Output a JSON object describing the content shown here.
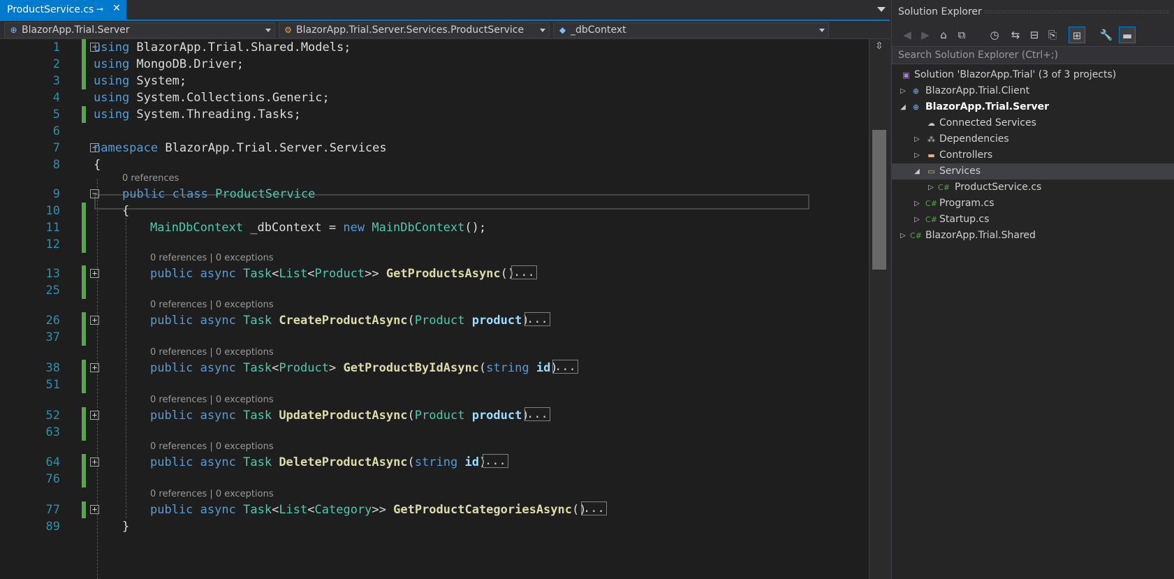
{
  "editor": {
    "tab": {
      "title": "ProductService.cs",
      "pin_glyph": "⊸",
      "close_glyph": "✕"
    },
    "nav": {
      "project": "BlazorApp.Trial.Server",
      "type": "BlazorApp.Trial.Server.Services.ProductService",
      "member": "_dbContext"
    },
    "lines": [
      {
        "n": "1",
        "text": "using BlazorApp.Trial.Shared.Models;"
      },
      {
        "n": "2",
        "text": "using MongoDB.Driver;"
      },
      {
        "n": "3",
        "text": "using System;"
      },
      {
        "n": "4",
        "text": "using System.Collections.Generic;"
      },
      {
        "n": "5",
        "text": "using System.Threading.Tasks;"
      },
      {
        "n": "6",
        "text": ""
      },
      {
        "n": "7",
        "text": "namespace BlazorApp.Trial.Server.Services"
      },
      {
        "n": "8",
        "text": "{"
      },
      {
        "n": "9",
        "text": "public class ProductService"
      },
      {
        "n": "10",
        "text": "{"
      },
      {
        "n": "11",
        "text": "MainDbContext _dbContext = new MainDbContext();"
      },
      {
        "n": "12",
        "text": ""
      },
      {
        "n": "13",
        "text": "public async Task<List<Product>> GetProductsAsync()"
      },
      {
        "n": "25",
        "text": ""
      },
      {
        "n": "26",
        "text": "public async Task CreateProductAsync(Product product)"
      },
      {
        "n": "37",
        "text": ""
      },
      {
        "n": "38",
        "text": "public async Task<Product> GetProductByIdAsync(string id)"
      },
      {
        "n": "51",
        "text": ""
      },
      {
        "n": "52",
        "text": "public async Task UpdateProductAsync(Product product)"
      },
      {
        "n": "63",
        "text": ""
      },
      {
        "n": "64",
        "text": "public async Task DeleteProductAsync(string id)"
      },
      {
        "n": "76",
        "text": ""
      },
      {
        "n": "77",
        "text": "public async Task<List<Category>> GetProductCategoriesAsync()"
      },
      {
        "n": "89",
        "text": "}"
      }
    ],
    "lens": {
      "class_refs": "0 references",
      "method_refs": "0 references | 0 exceptions"
    },
    "collapsed_marker": "..."
  },
  "solution_explorer": {
    "title": "Solution Explorer",
    "search_placeholder": "Search Solution Explorer (Ctrl+;)",
    "tree": [
      {
        "label": "Solution 'BlazorApp.Trial' (3 of 3 projects)"
      },
      {
        "label": "BlazorApp.Trial.Client"
      },
      {
        "label": "BlazorApp.Trial.Server"
      },
      {
        "label": "Connected Services"
      },
      {
        "label": "Dependencies"
      },
      {
        "label": "Controllers"
      },
      {
        "label": "Services"
      },
      {
        "label": "ProductService.cs"
      },
      {
        "label": "Program.cs"
      },
      {
        "label": "Startup.cs"
      },
      {
        "label": "BlazorApp.Trial.Shared"
      }
    ]
  },
  "colors": {
    "accent": "#007acc",
    "keyword": "#569cd6",
    "type": "#4ec9b0",
    "method": "#dcdcaa",
    "param": "#9cdcfe",
    "line_number": "#2b91af",
    "change_bar": "#57a64a"
  }
}
